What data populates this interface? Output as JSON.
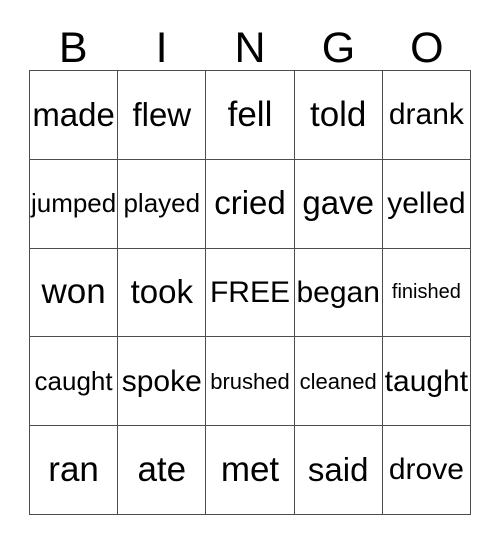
{
  "card": {
    "title": "BINGO",
    "header_letters": [
      "B",
      "I",
      "N",
      "G",
      "O"
    ],
    "free_space_label": "FREE",
    "free_space_position": {
      "row": 2,
      "col": 2
    },
    "grid_size": "5x5",
    "colors": {
      "background": "#ffffff",
      "text": "#000000",
      "grid_line": "#4d4d4d"
    },
    "rows": [
      [
        {
          "text": "made",
          "size": "fs-lg"
        },
        {
          "text": "flew",
          "size": "fs-lg"
        },
        {
          "text": "fell",
          "size": "fs-xl"
        },
        {
          "text": "told",
          "size": "fs-xl"
        },
        {
          "text": "drank",
          "size": "fs-md"
        }
      ],
      [
        {
          "text": "jumped",
          "size": "fs-sm"
        },
        {
          "text": "played",
          "size": "fs-sm"
        },
        {
          "text": "cried",
          "size": "fs-lg"
        },
        {
          "text": "gave",
          "size": "fs-lg"
        },
        {
          "text": "yelled",
          "size": "fs-md"
        }
      ],
      [
        {
          "text": "won",
          "size": "fs-xl"
        },
        {
          "text": "took",
          "size": "fs-lg"
        },
        {
          "text": "FREE",
          "size": "fs-md"
        },
        {
          "text": "began",
          "size": "fs-md"
        },
        {
          "text": "finished",
          "size": "fs-xxs"
        }
      ],
      [
        {
          "text": "caught",
          "size": "fs-sm"
        },
        {
          "text": "spoke",
          "size": "fs-md"
        },
        {
          "text": "brushed",
          "size": "fs-xs"
        },
        {
          "text": "cleaned",
          "size": "fs-xs"
        },
        {
          "text": "taught",
          "size": "fs-md"
        }
      ],
      [
        {
          "text": "ran",
          "size": "fs-xl"
        },
        {
          "text": "ate",
          "size": "fs-xl"
        },
        {
          "text": "met",
          "size": "fs-xl"
        },
        {
          "text": "said",
          "size": "fs-lg"
        },
        {
          "text": "drove",
          "size": "fs-md"
        }
      ]
    ]
  }
}
